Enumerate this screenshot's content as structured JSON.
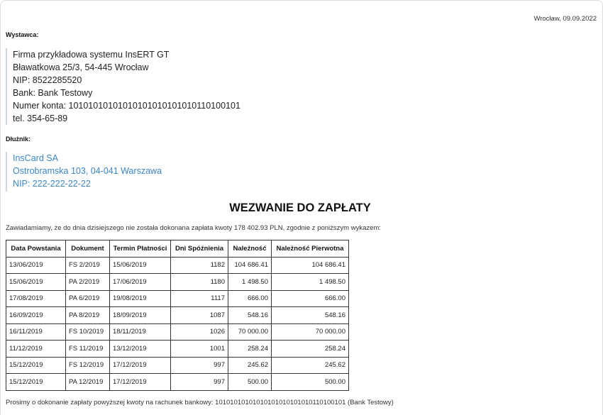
{
  "header": {
    "place_date": "Wrocław, 09.09.2022"
  },
  "issuer": {
    "label": "Wystawca:",
    "lines": [
      "Firma przykładowa systemu InsERT GT",
      "Bławatkowa 25/3, 54-445 Wrocław",
      "NIP: 8522285520",
      "Bank: Bank Testowy",
      "Numer konta: 10101010101010101010101010110100101",
      "tel. 354-65-89"
    ]
  },
  "debtor": {
    "label": "Dłużnik:",
    "lines": [
      "InsCard SA",
      "Ostrobramska 103, 04-041 Warszawa",
      "NIP: 222-222-22-22"
    ]
  },
  "colors": {
    "debtor_text": "#3a86c8",
    "border": "#333333"
  },
  "title": "WEZWANIE DO ZAPŁATY",
  "intro": "Zawiadamiamy, że do dnia dzisiejszego nie została dokonana zapłata kwoty 178 402.93 PLN, zgodnie z poniższym wykazem:",
  "table": {
    "headers": [
      "Data Powstania",
      "Dokument",
      "Termin Płatności",
      "Dni Spóźnienia",
      "Należność",
      "Należność Pierwotna"
    ],
    "rows": [
      [
        "13/06/2019",
        "FS 2/2019",
        "15/06/2019",
        "1182",
        "104 686.41",
        "104 686.41"
      ],
      [
        "15/06/2019",
        "PA 2/2019",
        "17/06/2019",
        "1180",
        "1 498.50",
        "1 498.50"
      ],
      [
        "17/08/2019",
        "PA 6/2019",
        "19/08/2019",
        "1117",
        "666.00",
        "666.00"
      ],
      [
        "16/09/2019",
        "PA 8/2019",
        "18/09/2019",
        "1087",
        "548.16",
        "548.16"
      ],
      [
        "16/11/2019",
        "FS 10/2019",
        "18/11/2019",
        "1026",
        "70 000.00",
        "70 000.00"
      ],
      [
        "11/12/2019",
        "FS 11/2019",
        "13/12/2019",
        "1001",
        "258.24",
        "258.24"
      ],
      [
        "15/12/2019",
        "FS 12/2019",
        "17/12/2019",
        "997",
        "245.62",
        "245.62"
      ],
      [
        "15/12/2019",
        "PA 12/2019",
        "17/12/2019",
        "997",
        "500.00",
        "500.00"
      ]
    ]
  },
  "footer": "Prosimy o dokonanie zapłaty powyższej kwoty na rachunek bankowy: 10101010101010101010101010110100101 (Bank Testowy)"
}
